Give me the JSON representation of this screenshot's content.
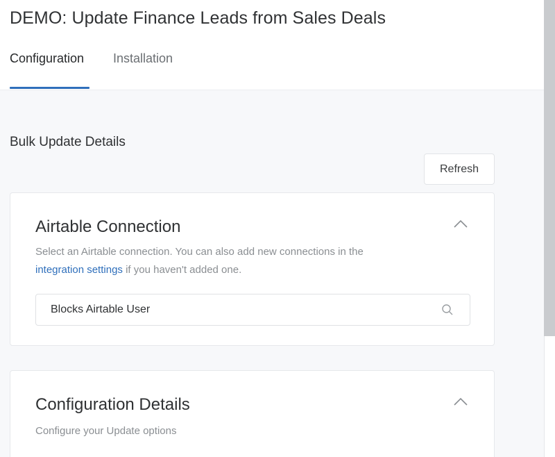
{
  "header": {
    "title": "DEMO: Update Finance Leads from Sales Deals",
    "tabs": [
      {
        "label": "Configuration",
        "active": true
      },
      {
        "label": "Installation",
        "active": false
      }
    ]
  },
  "main": {
    "section_title": "Bulk Update Details",
    "refresh_label": "Refresh",
    "airtable_card": {
      "title": "Airtable Connection",
      "desc_prefix": "Select an Airtable connection. You can also add new connections in the",
      "link_text": "integration settings",
      "desc_suffix": " if you haven't added one.",
      "selected_connection": "Blocks Airtable User",
      "icons": {
        "collapse": "chevron-up-icon",
        "search": "search-icon"
      }
    },
    "config_card": {
      "title": "Configuration Details",
      "desc": "Configure your Update options",
      "icons": {
        "collapse": "chevron-up-icon"
      }
    }
  },
  "colors": {
    "accent": "#2f6fbb",
    "background": "#f7f8fa",
    "card": "#ffffff",
    "muted_text": "#8a8e92"
  }
}
